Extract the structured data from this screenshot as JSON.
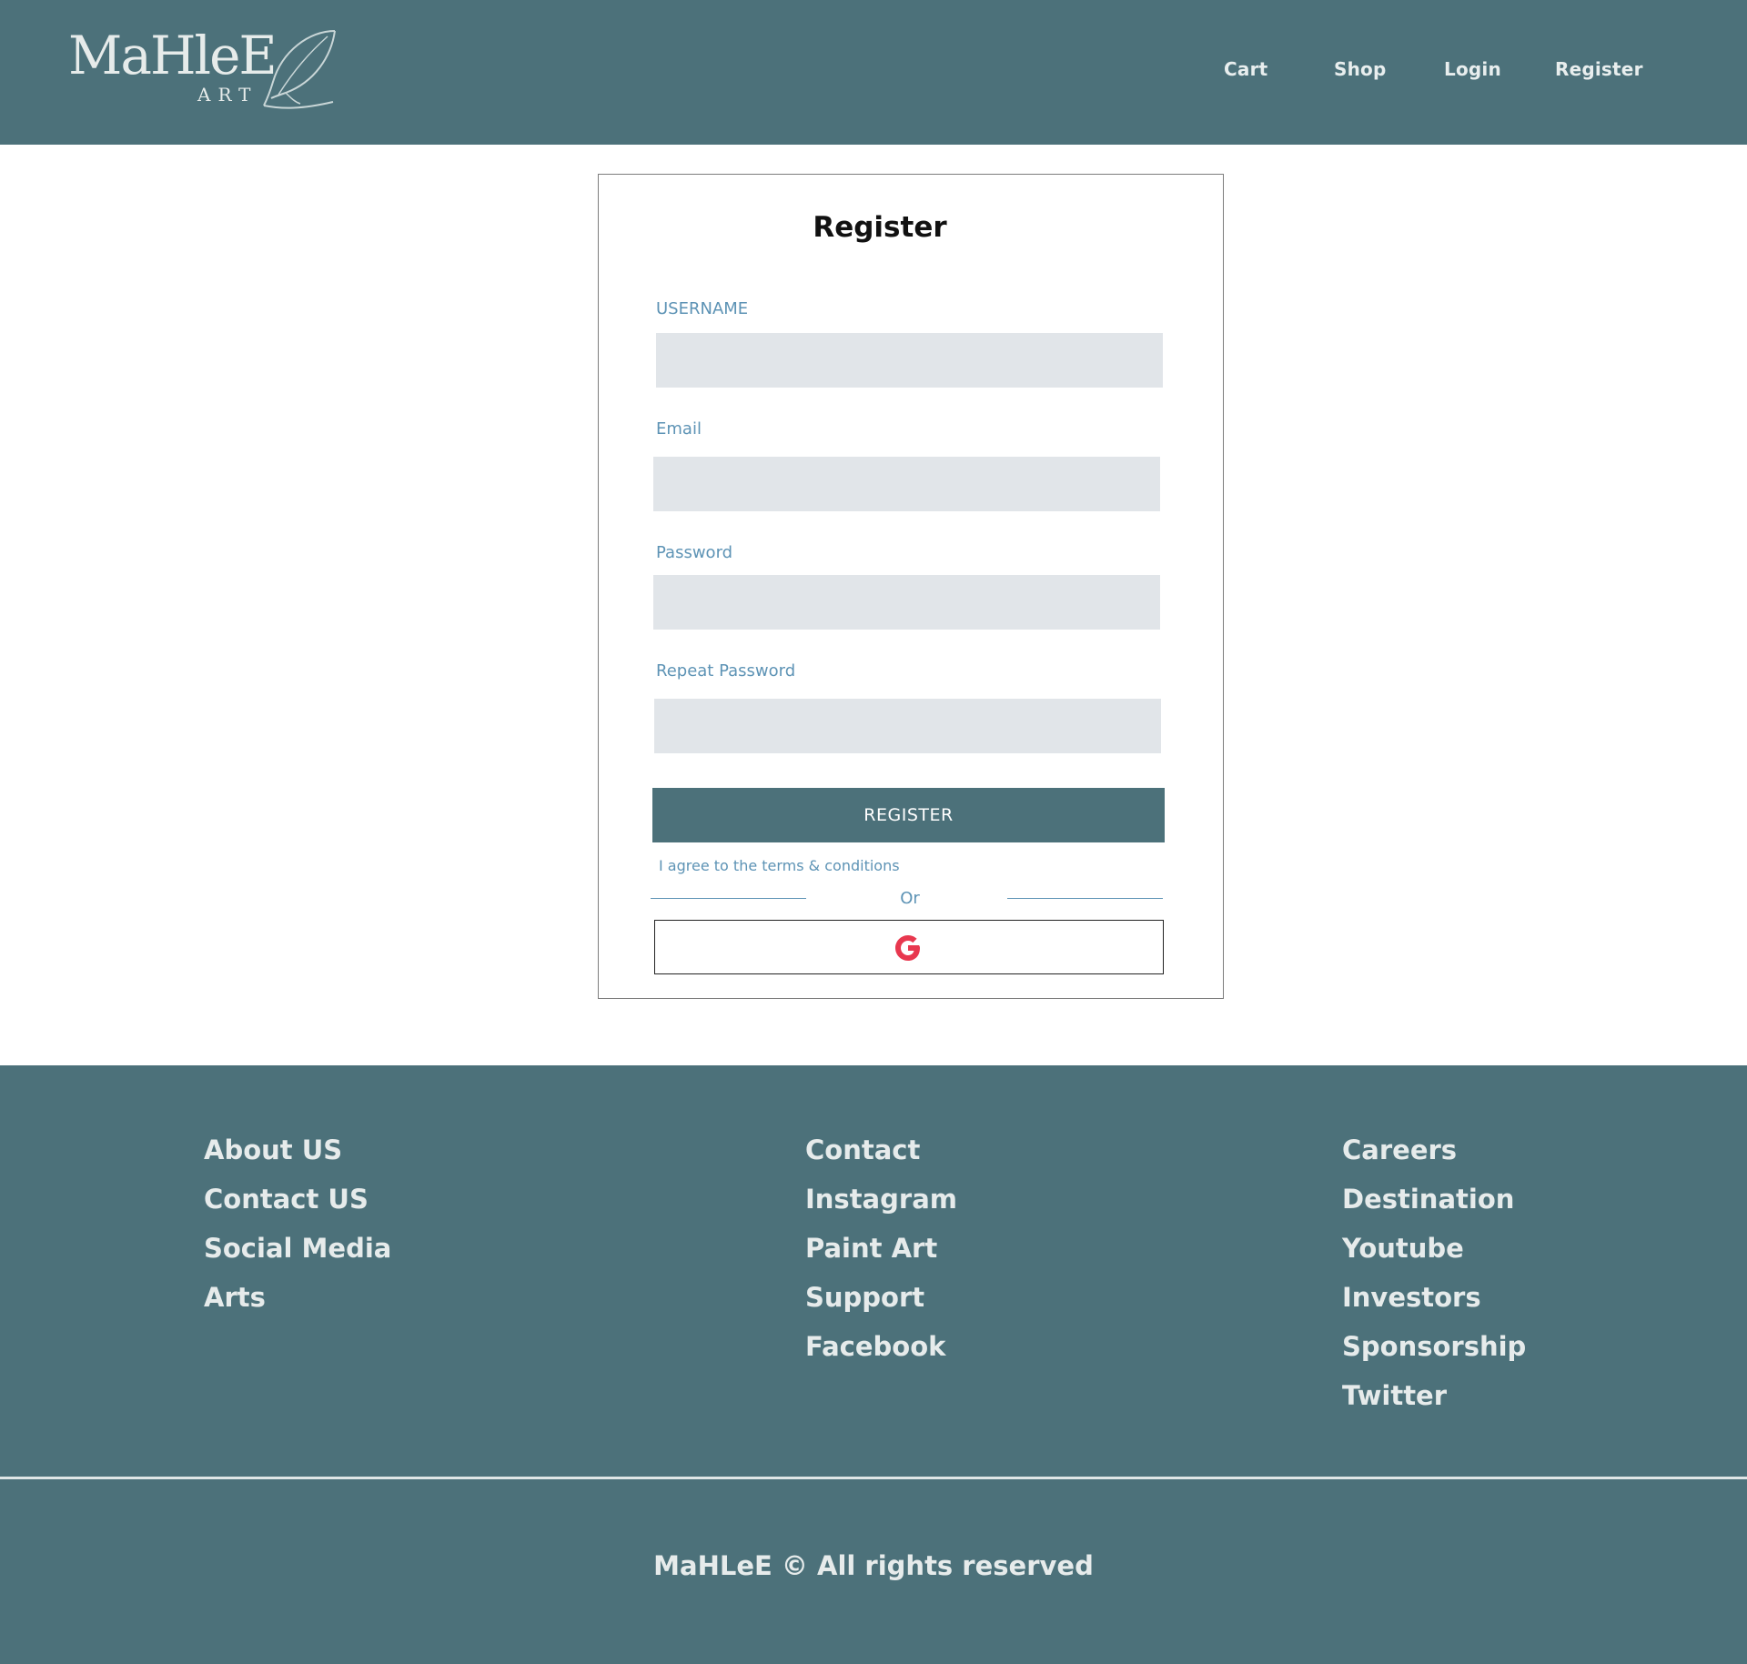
{
  "brand": {
    "logo_word": "MaHleE",
    "logo_sub": "ART"
  },
  "nav": {
    "items": [
      {
        "label": "Cart"
      },
      {
        "label": "Shop"
      },
      {
        "label": "Login"
      },
      {
        "label": "Register"
      }
    ]
  },
  "form": {
    "title": "Register",
    "fields": [
      {
        "label": "USERNAME",
        "value": "",
        "placeholder": ""
      },
      {
        "label": "Email",
        "value": "",
        "placeholder": ""
      },
      {
        "label": "Password",
        "value": "",
        "placeholder": ""
      },
      {
        "label": "Repeat Password",
        "value": "",
        "placeholder": ""
      }
    ],
    "submit_label": "REGISTER",
    "terms_text": "I agree to the terms & conditions",
    "divider_text": "Or",
    "google_icon": "google-g-icon"
  },
  "footer": {
    "columns": [
      {
        "links": [
          "About US",
          "Contact US",
          "Social Media",
          "Arts"
        ]
      },
      {
        "links": [
          "Contact",
          "Instagram",
          "Paint Art",
          "Support",
          "Facebook"
        ]
      },
      {
        "links": [
          "Careers",
          "Destination",
          "Youtube",
          "Investors",
          "Sponsorship",
          "Twitter"
        ]
      }
    ],
    "copyright": "MaHLeE © All rights reserved"
  },
  "colors": {
    "brand_teal": "#4c717a",
    "label_blue": "#5d93b5",
    "input_gray": "#e1e5e9",
    "google_red": "#e8384f"
  }
}
